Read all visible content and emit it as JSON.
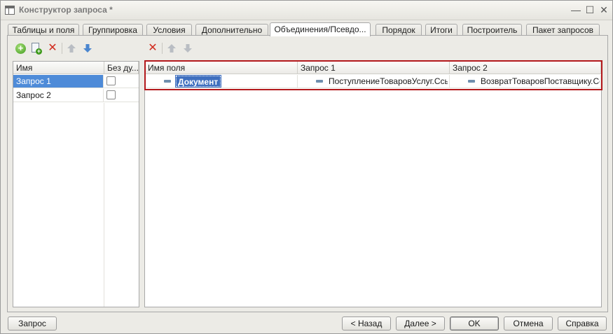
{
  "window": {
    "title": "Конструктор запроса *",
    "minimize": "—",
    "maximize": "☐",
    "close": "✕"
  },
  "tabs": [
    {
      "label": "Таблицы и поля"
    },
    {
      "label": "Группировка"
    },
    {
      "label": "Условия"
    },
    {
      "label": "Дополнительно"
    },
    {
      "label": "Объединения/Псевдо..."
    },
    {
      "label": "Порядок"
    },
    {
      "label": "Итоги"
    },
    {
      "label": "Построитель"
    },
    {
      "label": "Пакет запросов"
    }
  ],
  "active_tab": "Объединения/Псевдо...",
  "left_toolbar": {
    "add": "+",
    "add_copy": "+",
    "delete": "✕"
  },
  "right_toolbar": {
    "delete": "✕"
  },
  "queries_list": {
    "columns": [
      "Имя",
      "Без ду..."
    ],
    "rows": [
      {
        "name": "Запрос 1",
        "no_duplicates": false
      },
      {
        "name": "Запрос 2",
        "no_duplicates": false
      }
    ]
  },
  "aliases_table": {
    "columns": [
      "Имя поля",
      "Запрос 1",
      "Запрос 2"
    ],
    "rows": [
      {
        "field_name": "Документ",
        "query1": "ПоступлениеТоваровУслуг.Ссылка",
        "query2": "ВозвратТоваровПоставщику.Ссылка"
      }
    ]
  },
  "colors": {
    "selection": "#4e8bd8",
    "edit_highlight": "#3f6fbf",
    "annotation_border": "#b3191c",
    "delete_icon": "#d12b1e",
    "add_icon": "#3e9a1c",
    "arrow_icon": "#4a86cf"
  },
  "buttons": {
    "query": "Запрос",
    "back": "< Назад",
    "next": "Далее >",
    "ok": "OK",
    "cancel": "Отмена",
    "help": "Справка"
  }
}
